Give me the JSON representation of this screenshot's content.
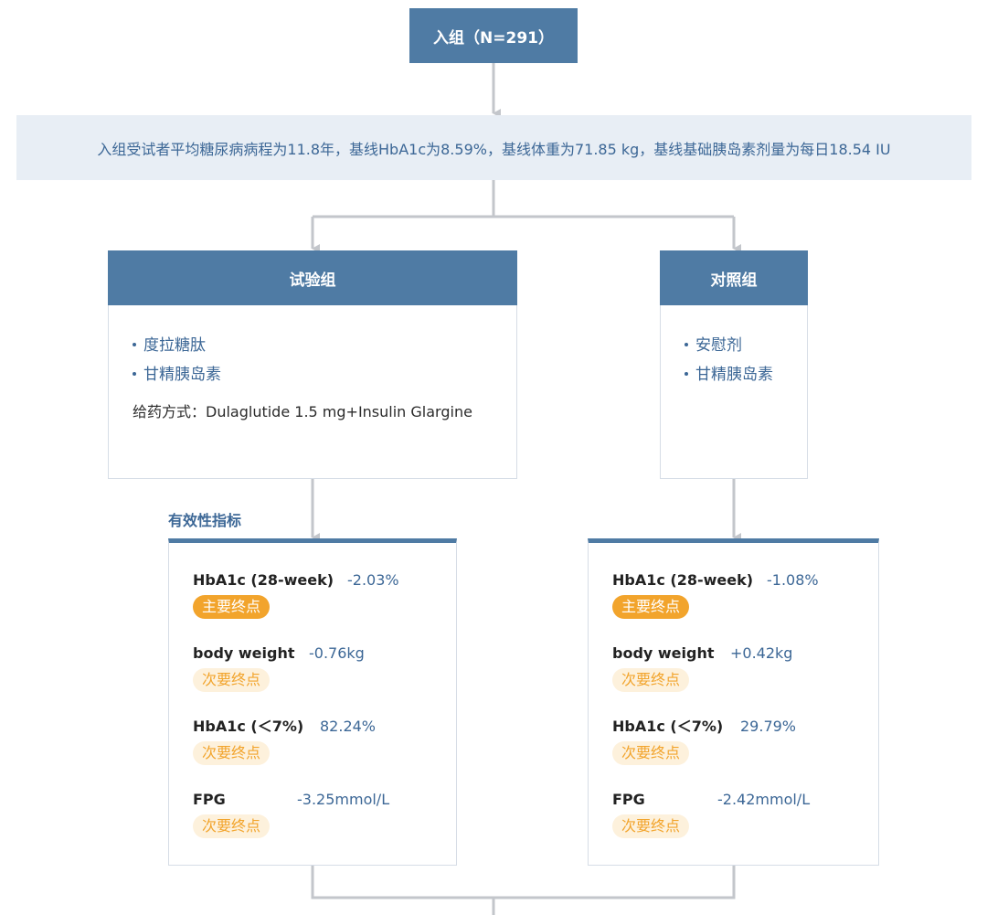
{
  "enrollment": {
    "label": "入组（N=291）"
  },
  "summary": {
    "text": "入组受试者平均糖尿病病程为11.8年，基线HbA1c为8.59%，基线体重为71.85 kg，基线基础胰岛素剂量为每日18.54 IU"
  },
  "efficacy_title": "有效性指标",
  "groups": [
    {
      "title": "试验组",
      "drugs": [
        "度拉糖肽",
        "甘精胰岛素"
      ],
      "dosing": "给药方式：Dulaglutide 1.5 mg+Insulin Glargine",
      "endpoints": [
        {
          "name": "HbA1c (28-week)",
          "value": "-2.03%",
          "badge": "主要终点"
        },
        {
          "name": "body weight",
          "value": "-0.76kg",
          "badge": "次要终点"
        },
        {
          "name": "HbA1c (＜7%)",
          "value": "82.24%",
          "badge": "次要终点"
        },
        {
          "name": "FPG",
          "value": "-3.25mmol/L",
          "badge": "次要终点"
        }
      ]
    },
    {
      "title": "对照组",
      "drugs": [
        "安慰剂",
        "甘精胰岛素"
      ],
      "endpoints": [
        {
          "name": "HbA1c (28-week)",
          "value": "-1.08%",
          "badge": "主要终点"
        },
        {
          "name": "body weight",
          "value": "+0.42kg",
          "badge": "次要终点"
        },
        {
          "name": "HbA1c (＜7%)",
          "value": "29.79%",
          "badge": "次要终点"
        },
        {
          "name": "FPG",
          "value": "-2.42mmol/L",
          "badge": "次要终点"
        }
      ]
    }
  ],
  "colors": {
    "header": "#4f7ba4",
    "primary_badge": "#f2a42c",
    "connector": "#c3c6cb"
  }
}
